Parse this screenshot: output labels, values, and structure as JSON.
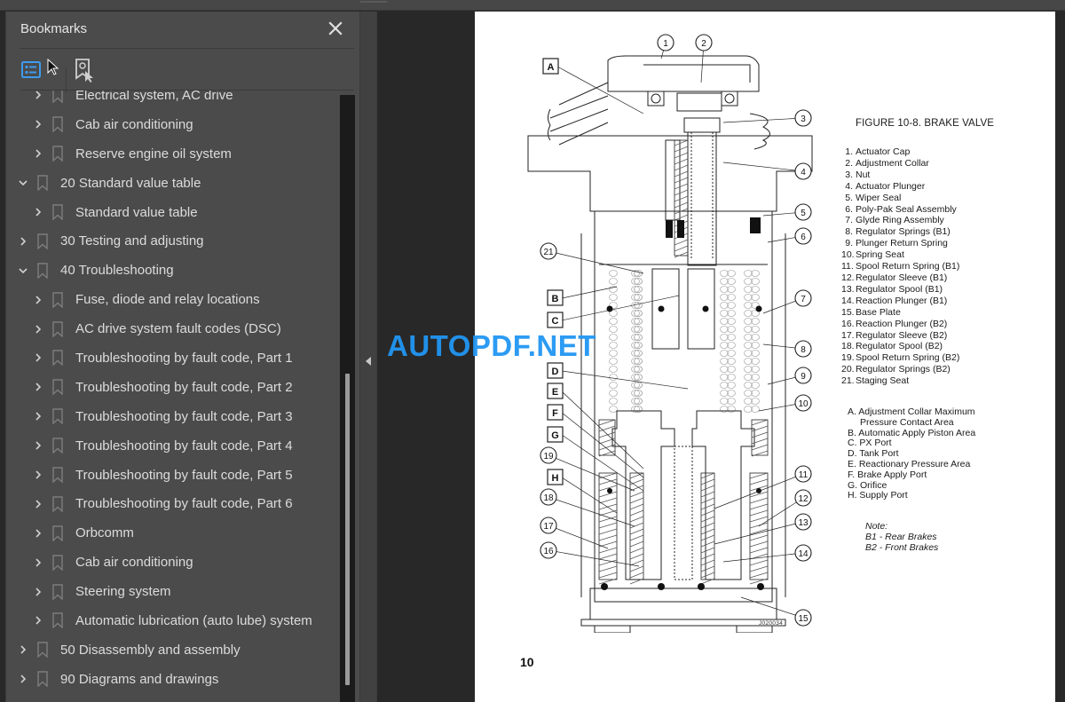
{
  "app": {
    "sidebar_title": "Bookmarks",
    "close_tooltip": "Close"
  },
  "bookmarks": [
    {
      "level": 1,
      "expanded": false,
      "label": "Electrical system, AC drive"
    },
    {
      "level": 1,
      "expanded": false,
      "label": "Cab air conditioning"
    },
    {
      "level": 1,
      "expanded": false,
      "label": "Reserve engine oil system"
    },
    {
      "level": 0,
      "expanded": true,
      "label": "20 Standard value table"
    },
    {
      "level": 1,
      "expanded": false,
      "label": "Standard value table"
    },
    {
      "level": 0,
      "expanded": false,
      "label": "30 Testing and adjusting"
    },
    {
      "level": 0,
      "expanded": true,
      "label": "40 Troubleshooting"
    },
    {
      "level": 1,
      "expanded": false,
      "label": "Fuse, diode and relay locations"
    },
    {
      "level": 1,
      "expanded": false,
      "label": "AC drive system fault codes (DSC)"
    },
    {
      "level": 1,
      "expanded": false,
      "label": "Troubleshooting by fault code, Part 1"
    },
    {
      "level": 1,
      "expanded": false,
      "label": "Troubleshooting by fault code, Part 2"
    },
    {
      "level": 1,
      "expanded": false,
      "label": "Troubleshooting by fault code, Part 3"
    },
    {
      "level": 1,
      "expanded": false,
      "label": "Troubleshooting by fault code, Part 4"
    },
    {
      "level": 1,
      "expanded": false,
      "label": "Troubleshooting by fault code, Part 5"
    },
    {
      "level": 1,
      "expanded": false,
      "label": "Troubleshooting by fault code, Part 6"
    },
    {
      "level": 1,
      "expanded": false,
      "label": "Orbcomm"
    },
    {
      "level": 1,
      "expanded": false,
      "label": "Cab air conditioning"
    },
    {
      "level": 1,
      "expanded": false,
      "label": "Steering system"
    },
    {
      "level": 1,
      "expanded": false,
      "label": "Automatic lubrication (auto lube) system"
    },
    {
      "level": 0,
      "expanded": false,
      "label": "50 Disassembly and assembly"
    },
    {
      "level": 0,
      "expanded": false,
      "label": "90 Diagrams and drawings"
    }
  ],
  "scrollbar": {
    "position_fraction": 0.46,
    "visible_fraction": 0.51
  },
  "page": {
    "figure_title": "FIGURE 10-8. BRAKE VALVE",
    "parts": [
      {
        "num": "1.",
        "name": "Actuator Cap"
      },
      {
        "num": "2.",
        "name": "Adjustment Collar"
      },
      {
        "num": "3.",
        "name": "Nut"
      },
      {
        "num": "4.",
        "name": "Actuator Plunger"
      },
      {
        "num": "5.",
        "name": "Wiper Seal"
      },
      {
        "num": "6.",
        "name": "Poly-Pak Seal Assembly"
      },
      {
        "num": "7.",
        "name": "Glyde Ring Assembly"
      },
      {
        "num": "8.",
        "name": "Regulator Springs (B1)"
      },
      {
        "num": "9.",
        "name": "Plunger Return Spring"
      },
      {
        "num": "10.",
        "name": "Spring Seat"
      },
      {
        "num": "11.",
        "name": "Spool Return Spring (B1)"
      },
      {
        "num": "12.",
        "name": "Regulator Sleeve (B1)"
      },
      {
        "num": "13.",
        "name": "Regulator Spool (B1)"
      },
      {
        "num": "14.",
        "name": "Reaction Plunger (B1)"
      },
      {
        "num": "15.",
        "name": "Base Plate"
      },
      {
        "num": "16.",
        "name": "Reaction Plunger (B2)"
      },
      {
        "num": "17.",
        "name": "Regulator Sleeve (B2)"
      },
      {
        "num": "18.",
        "name": "Regulator Spool (B2)"
      },
      {
        "num": "19.",
        "name": "Spool Return Spring (B2)"
      },
      {
        "num": "20.",
        "name": "Regulator Springs (B2)"
      },
      {
        "num": "21.",
        "name": "Staging Seat"
      }
    ],
    "areas": [
      "A. Adjustment Collar Maximum",
      "Pressure Contact Area",
      "B. Automatic Apply Piston Area",
      "C. PX Port",
      "D. Tank Port",
      "E. Reactionary Pressure Area",
      "F. Brake Apply Port",
      "G. Orifice",
      "H. Supply Port"
    ],
    "note_title": "Note:",
    "note_lines": [
      "B1 - Rear Brakes",
      "B2 - Front Brakes"
    ],
    "page_number": "10",
    "drawing_id": "J020034",
    "callouts_numbered": [
      "1",
      "2",
      "3",
      "4",
      "5",
      "6",
      "7",
      "8",
      "9",
      "10",
      "11",
      "12",
      "13",
      "14",
      "15",
      "16",
      "17",
      "18",
      "19",
      "21"
    ],
    "callouts_letters": [
      "A",
      "B",
      "C",
      "D",
      "E",
      "F",
      "G",
      "H"
    ]
  },
  "watermark": {
    "text": "AUTOPDF.NET",
    "color": "#2196f3"
  },
  "colors": {
    "accent": "#3d9bef",
    "panel": "#4b4b4b",
    "viewer_bg": "#282828"
  }
}
